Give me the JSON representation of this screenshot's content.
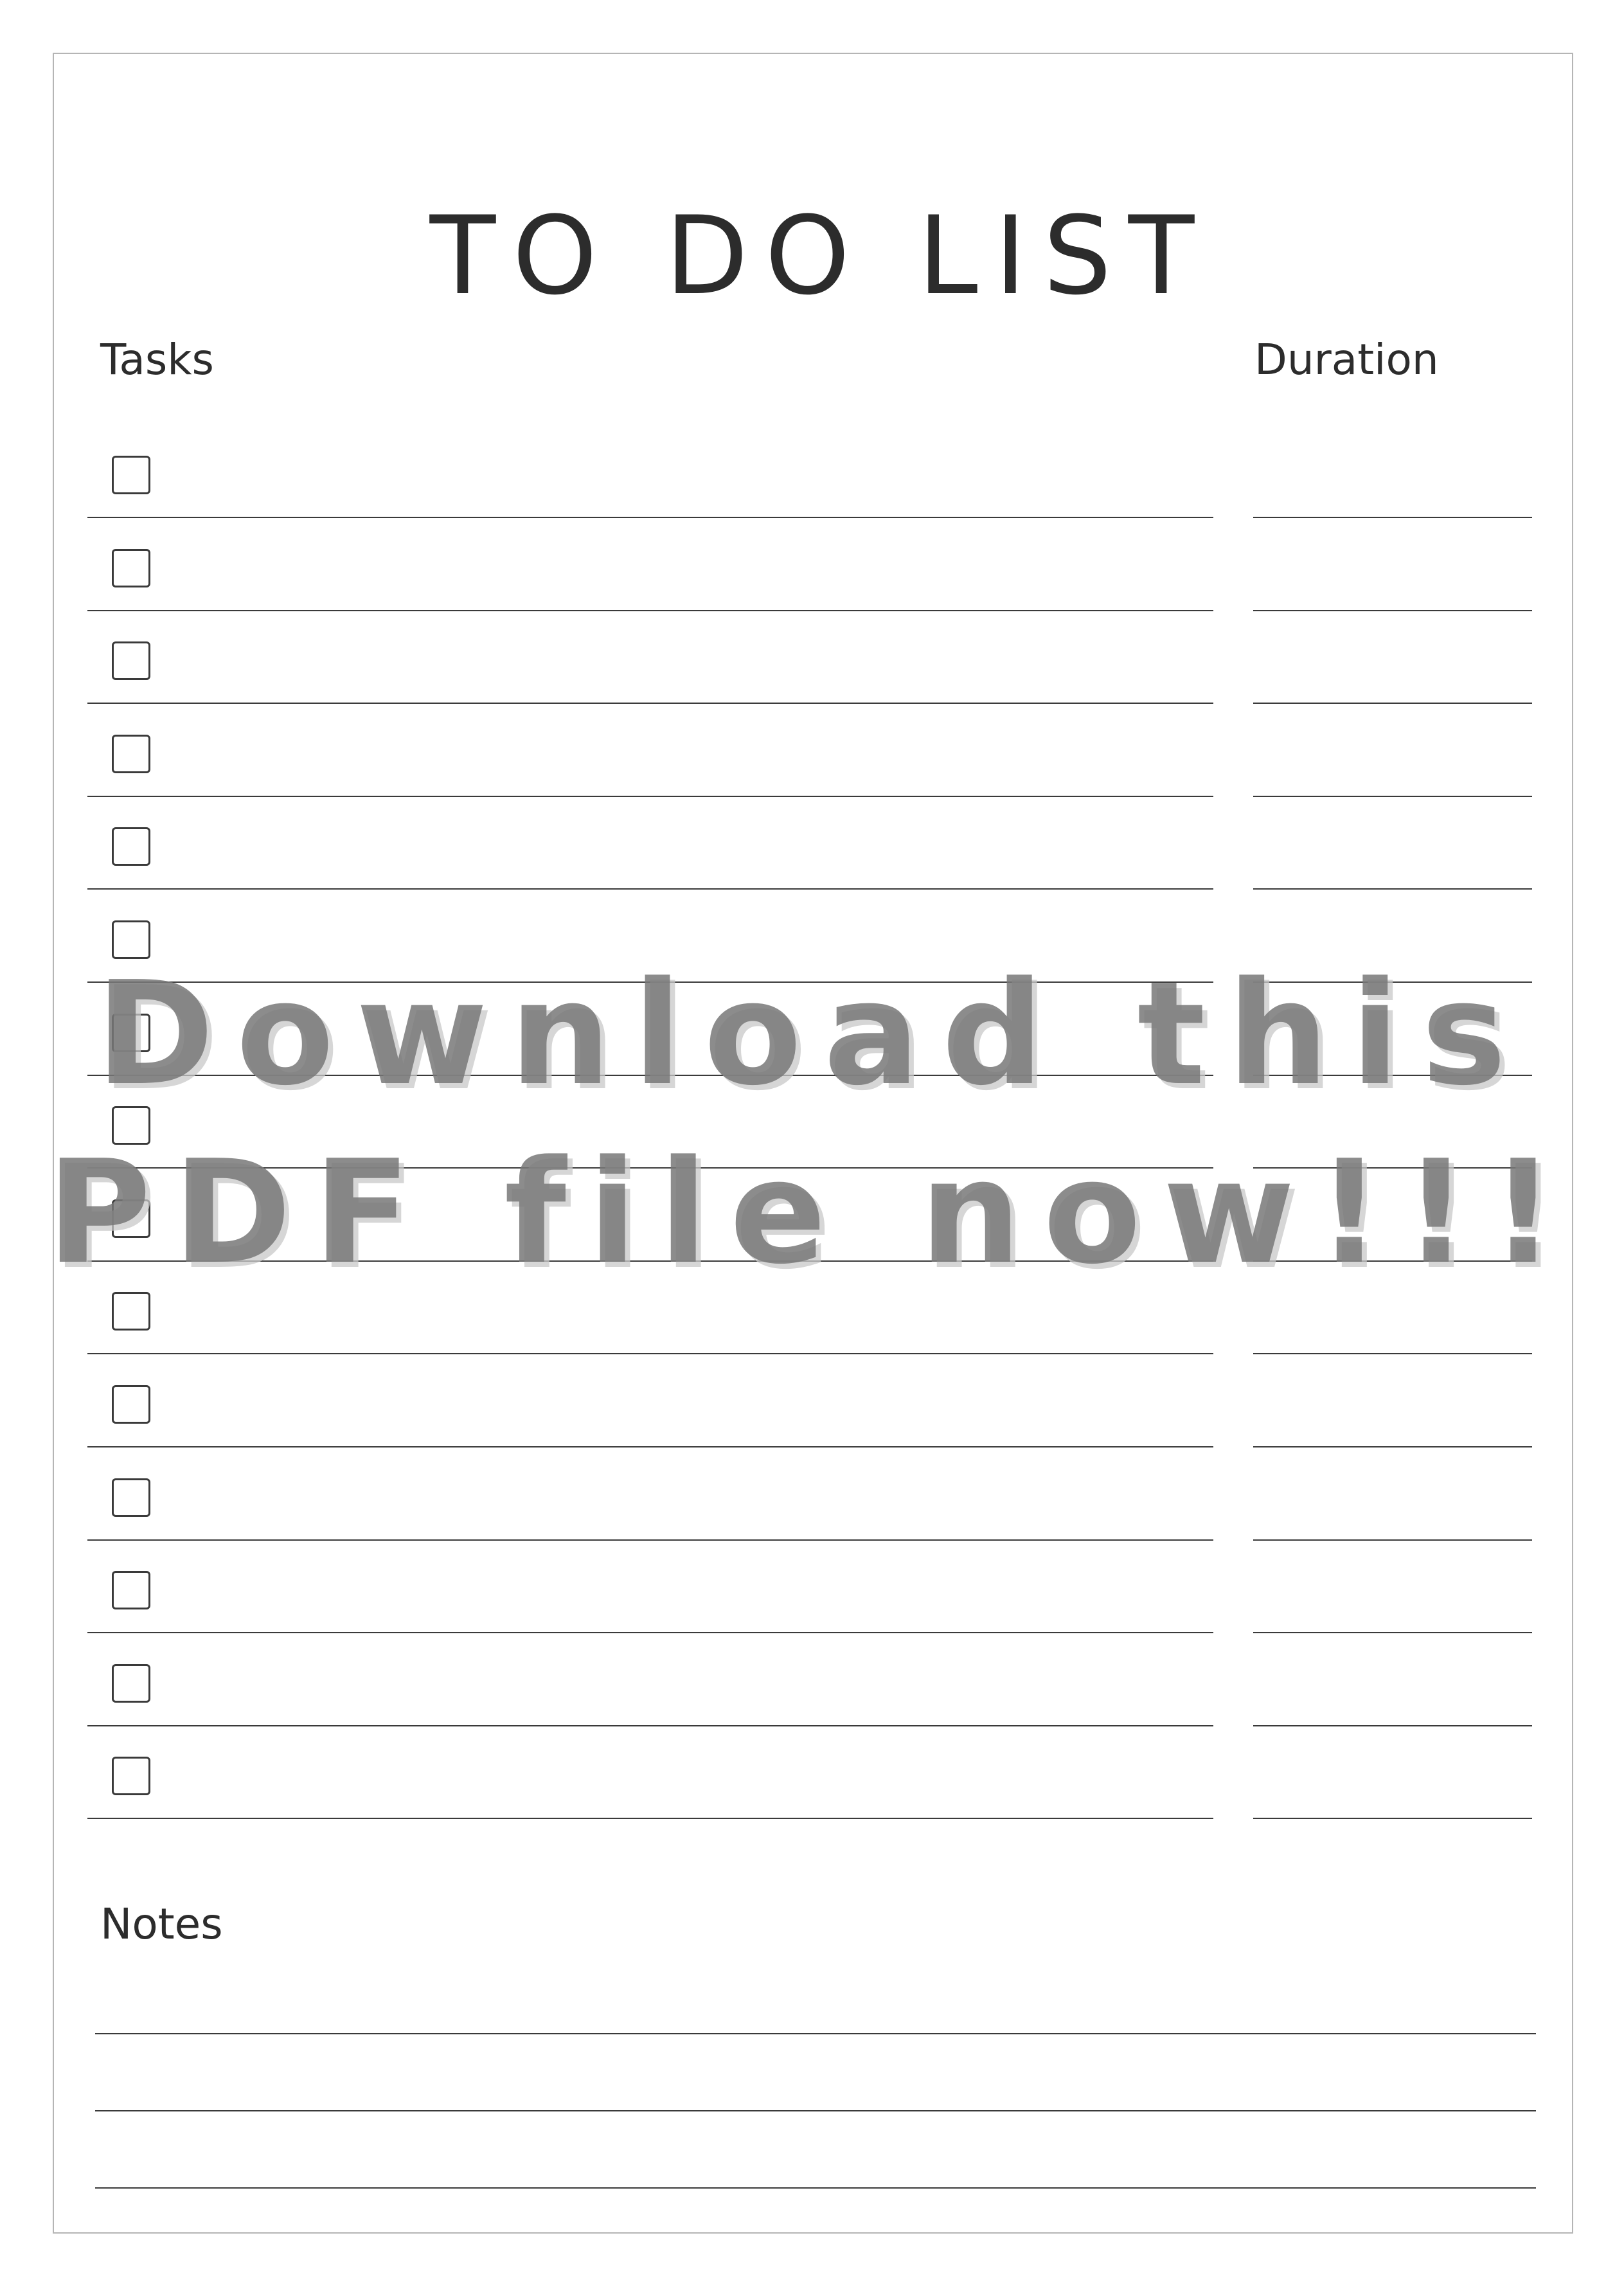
{
  "title": "TO DO LIST",
  "columns": {
    "tasks": "Tasks",
    "duration": "Duration"
  },
  "task_rows": [
    {
      "checked": false
    },
    {
      "checked": false
    },
    {
      "checked": false
    },
    {
      "checked": false
    },
    {
      "checked": false
    },
    {
      "checked": false
    },
    {
      "checked": false
    },
    {
      "checked": false
    },
    {
      "checked": false
    },
    {
      "checked": false
    },
    {
      "checked": false
    },
    {
      "checked": false
    },
    {
      "checked": false
    },
    {
      "checked": false
    },
    {
      "checked": false
    }
  ],
  "notes": {
    "heading": "Notes",
    "line_count": 3
  },
  "watermark": {
    "line1": "Download this",
    "line2": "PDF file now!!!"
  },
  "colors": {
    "ink": "#2c2c2c",
    "border": "#b5b5b5",
    "watermark": "#787878"
  },
  "icons": {
    "task_checkbox": "checkbox-icon"
  }
}
